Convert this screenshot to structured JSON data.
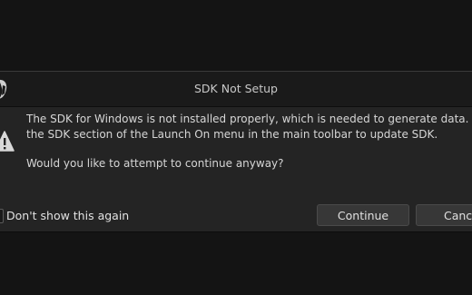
{
  "dialog": {
    "title": "SDK Not Setup",
    "message_line_1": "The SDK for Windows is not installed properly, which is needed to generate data. Check",
    "message_line_2": "the SDK section of the Launch On menu in the main toolbar to update SDK.",
    "message_line_3": "Would you like to attempt to continue anyway?",
    "dont_show_label": "Don't show this again",
    "dont_show_checked": false,
    "continue_label": "Continue",
    "cancel_label": "Cancel"
  },
  "icons": {
    "logo": "unreal-logo-icon",
    "warning": "warning-icon"
  },
  "colors": {
    "dialog_bg": "#242424",
    "title_bar_bg": "#1a1a1a",
    "button_bg": "#373737",
    "text": "#d6d6d6"
  }
}
